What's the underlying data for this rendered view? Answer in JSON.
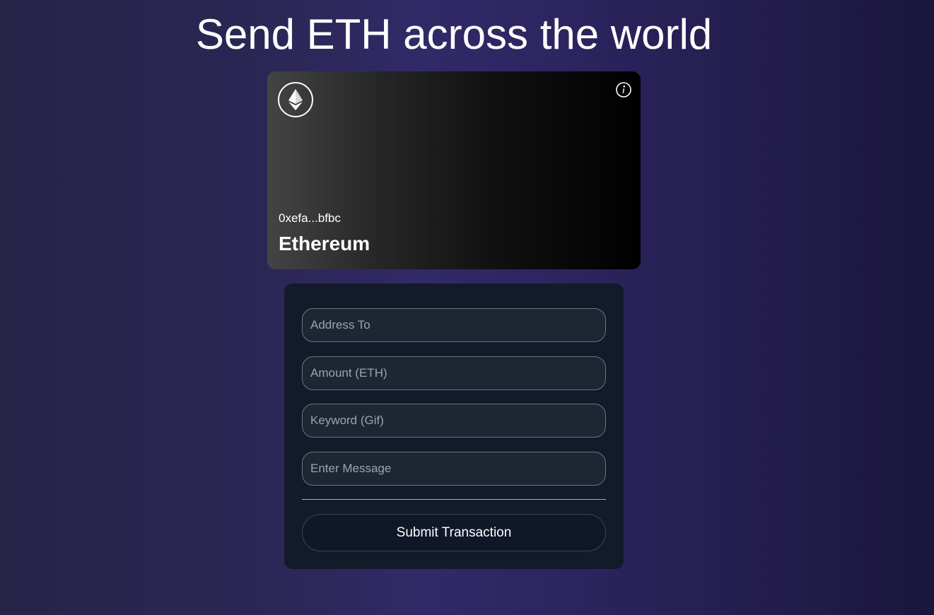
{
  "page": {
    "headline": "Send ETH across the world"
  },
  "card": {
    "logo_icon": "ethereum-icon",
    "info_icon": "info-icon",
    "address": "0xefa...bfbc",
    "network": "Ethereum"
  },
  "form": {
    "address_placeholder": "Address To",
    "amount_placeholder": "Amount (ETH)",
    "keyword_placeholder": "Keyword (Gif)",
    "message_placeholder": "Enter Message",
    "submit_label": "Submit Transaction"
  },
  "colors": {
    "background": "#2b2756",
    "card_start": "#444444",
    "card_end": "#000000",
    "panel": "#131a2a",
    "input_bg": "#1f2633",
    "input_border": "#6b7280",
    "placeholder": "#9ca3af"
  }
}
